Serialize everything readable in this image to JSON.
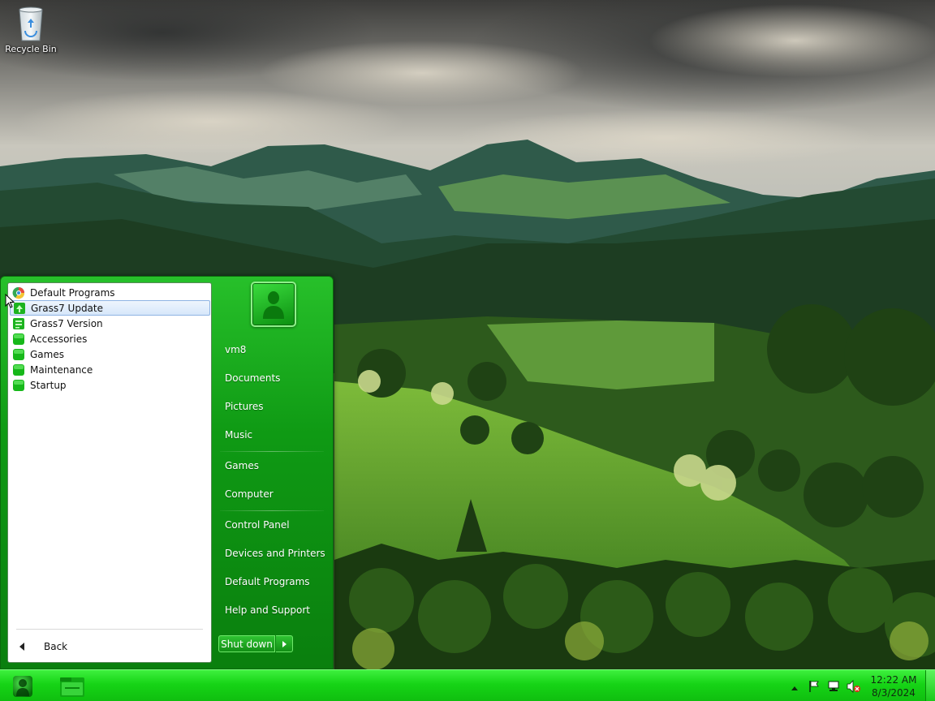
{
  "desktop": {
    "icons": [
      {
        "label": "Recycle Bin",
        "icon": "recycle-bin-icon"
      }
    ]
  },
  "start_menu": {
    "programs": [
      {
        "label": "Default Programs",
        "icon": "default-programs-icon"
      },
      {
        "label": "Grass7 Update",
        "icon": "update-icon",
        "selected": true
      },
      {
        "label": "Grass7 Version",
        "icon": "version-icon"
      },
      {
        "label": "Accessories",
        "icon": "folder-icon"
      },
      {
        "label": "Games",
        "icon": "folder-icon"
      },
      {
        "label": "Maintenance",
        "icon": "folder-icon"
      },
      {
        "label": "Startup",
        "icon": "folder-icon"
      }
    ],
    "back_label": "Back",
    "user_picture_icon": "user-avatar-icon",
    "right_links": [
      {
        "label": "vm8"
      },
      {
        "label": "Documents"
      },
      {
        "label": "Pictures"
      },
      {
        "label": "Music"
      },
      {
        "label": "Games"
      },
      {
        "label": "Computer"
      },
      {
        "label": "Control Panel"
      },
      {
        "label": "Devices and Printers"
      },
      {
        "label": "Default Programs"
      },
      {
        "label": "Help and Support"
      }
    ],
    "shutdown_label": "Shut down"
  },
  "taskbar": {
    "start_icon": "start-orb-icon",
    "pinned": [
      {
        "icon": "file-explorer-icon"
      }
    ],
    "tray_icons": [
      "show-hidden-icons-arrow",
      "action-center-flag-icon",
      "network-icon",
      "volume-muted-icon"
    ],
    "clock": {
      "time": "12:22 AM",
      "date": "8/3/2024"
    }
  },
  "colors": {
    "accent": "#0f9a14",
    "taskbar": "#16d416",
    "selection": "#d6e7fa"
  }
}
